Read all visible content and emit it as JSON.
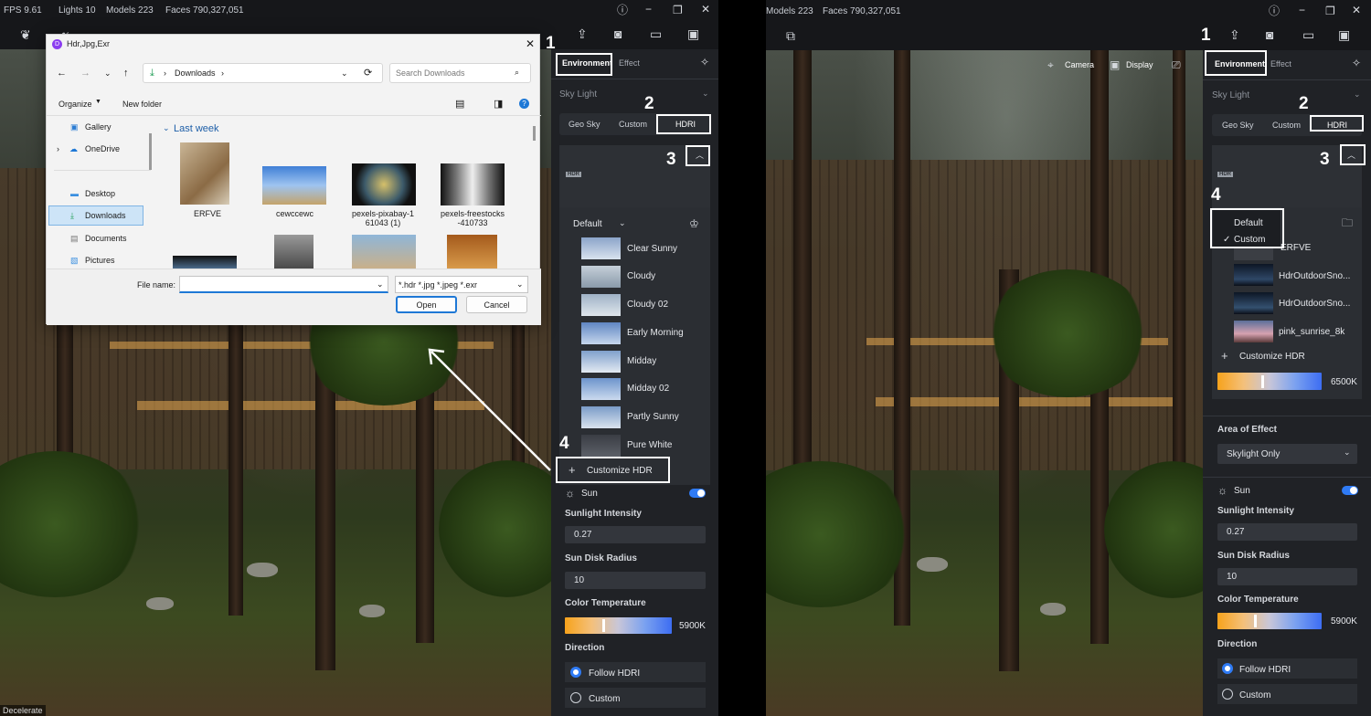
{
  "left": {
    "topbar": {
      "fps": "FPS 9.61",
      "lights": "Lights 10",
      "models": "Models 223",
      "faces": "Faces 790,327,051"
    },
    "status": "Decelerate",
    "tabs": [
      "Environment",
      "Effect"
    ],
    "sky_light": "Sky Light",
    "sky_modes": [
      "Geo Sky",
      "Custom",
      "HDRI"
    ],
    "hdr_badge": "HDR",
    "preset_dropdown": "Default",
    "presets": [
      "Clear Sunny",
      "Cloudy",
      "Cloudy 02",
      "Early Morning",
      "Midday",
      "Midday 02",
      "Partly Sunny",
      "Pure White"
    ],
    "customize_hdr": "Customize HDR",
    "sun": "Sun",
    "sunlight_intensity_label": "Sunlight Intensity",
    "sunlight_intensity": "0.27",
    "sun_disk_radius_label": "Sun Disk Radius",
    "sun_disk_radius": "10",
    "color_temp_label": "Color Temperature",
    "color_temp": "5900K",
    "color_temp_level": 0.36,
    "direction_label": "Direction",
    "direction_options": [
      "Follow HDRI",
      "Custom"
    ]
  },
  "dialog": {
    "title": "Hdr,Jpg,Exr",
    "path": "Downloads",
    "search_placeholder": "Search Downloads",
    "organize": "Organize",
    "new_folder": "New folder",
    "nav": [
      "Gallery",
      "OneDrive",
      "Desktop",
      "Downloads",
      "Documents",
      "Pictures"
    ],
    "group": "Last week",
    "files": [
      "ERFVE",
      "cewccewc",
      "pexels-pixabay-1\n61043 (1)",
      "pexels-freestocks\n-410733"
    ],
    "file_name_label": "File name:",
    "file_type": "*.hdr *.jpg *.jpeg *.exr",
    "open": "Open",
    "cancel": "Cancel"
  },
  "right": {
    "topbar": {
      "models": "Models 223",
      "faces": "Faces 790,327,051"
    },
    "viewport_buttons": [
      "Camera",
      "Display"
    ],
    "tabs": [
      "Environment",
      "Effect"
    ],
    "sky_light": "Sky Light",
    "sky_modes": [
      "Geo Sky",
      "Custom",
      "HDRI"
    ],
    "hdr_badge": "HDR",
    "menu_items": [
      "Default",
      "Custom"
    ],
    "menu_checked": "✓",
    "list_items": [
      "ERFVE",
      "HdrOutdoorSno...",
      "HdrOutdoorSno...",
      "pink_sunrise_8k"
    ],
    "customize_hdr": "Customize HDR",
    "hdr_temp": "6500K",
    "hdr_temp_level": 0.43,
    "area_label": "Area of Effect",
    "area_value": "Skylight Only",
    "sun": "Sun",
    "sunlight_intensity_label": "Sunlight Intensity",
    "sunlight_intensity": "0.27",
    "sun_disk_radius_label": "Sun Disk Radius",
    "sun_disk_radius": "10",
    "color_temp_label": "Color Temperature",
    "color_temp": "5900K",
    "color_temp_level": 0.36,
    "direction_label": "Direction",
    "direction_options": [
      "Follow HDRI",
      "Custom"
    ]
  },
  "steps": [
    "1",
    "2",
    "3",
    "4"
  ]
}
